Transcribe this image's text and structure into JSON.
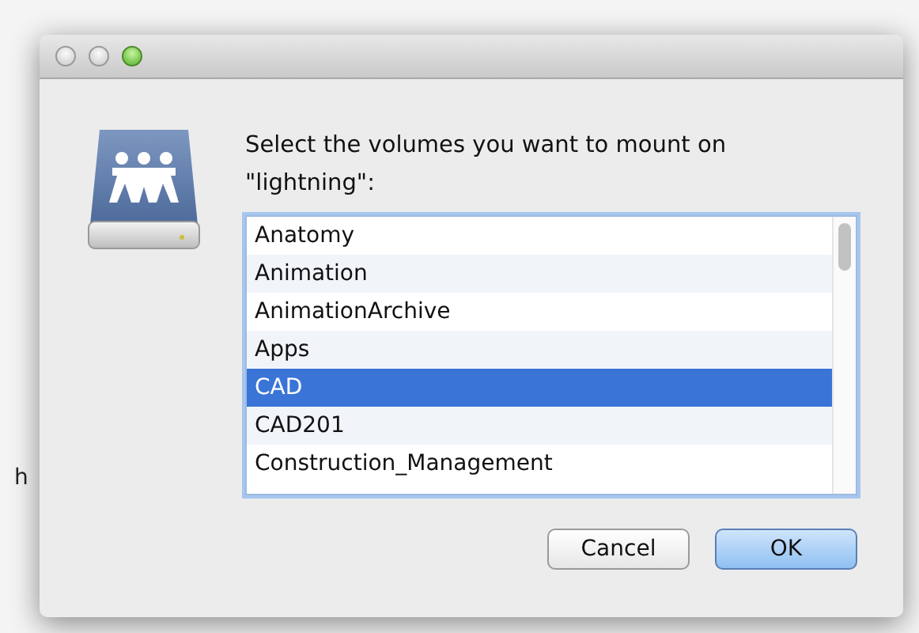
{
  "background": {
    "text_fragment": "h"
  },
  "window": {
    "buttons": [
      {
        "kind": "close"
      },
      {
        "kind": "minimize"
      },
      {
        "kind": "zoom"
      }
    ]
  },
  "dialog": {
    "message": "Select the volumes you want to mount on \"lightning\":",
    "volumes": [
      {
        "label": "Anatomy",
        "selected": false
      },
      {
        "label": "Animation",
        "selected": false
      },
      {
        "label": "AnimationArchive",
        "selected": false
      },
      {
        "label": "Apps",
        "selected": false
      },
      {
        "label": "CAD",
        "selected": true
      },
      {
        "label": "CAD201",
        "selected": false
      },
      {
        "label": "Construction_Management",
        "selected": false
      }
    ],
    "buttons": [
      {
        "label": "Cancel",
        "kind": "default"
      },
      {
        "label": "OK",
        "kind": "primary"
      }
    ]
  }
}
